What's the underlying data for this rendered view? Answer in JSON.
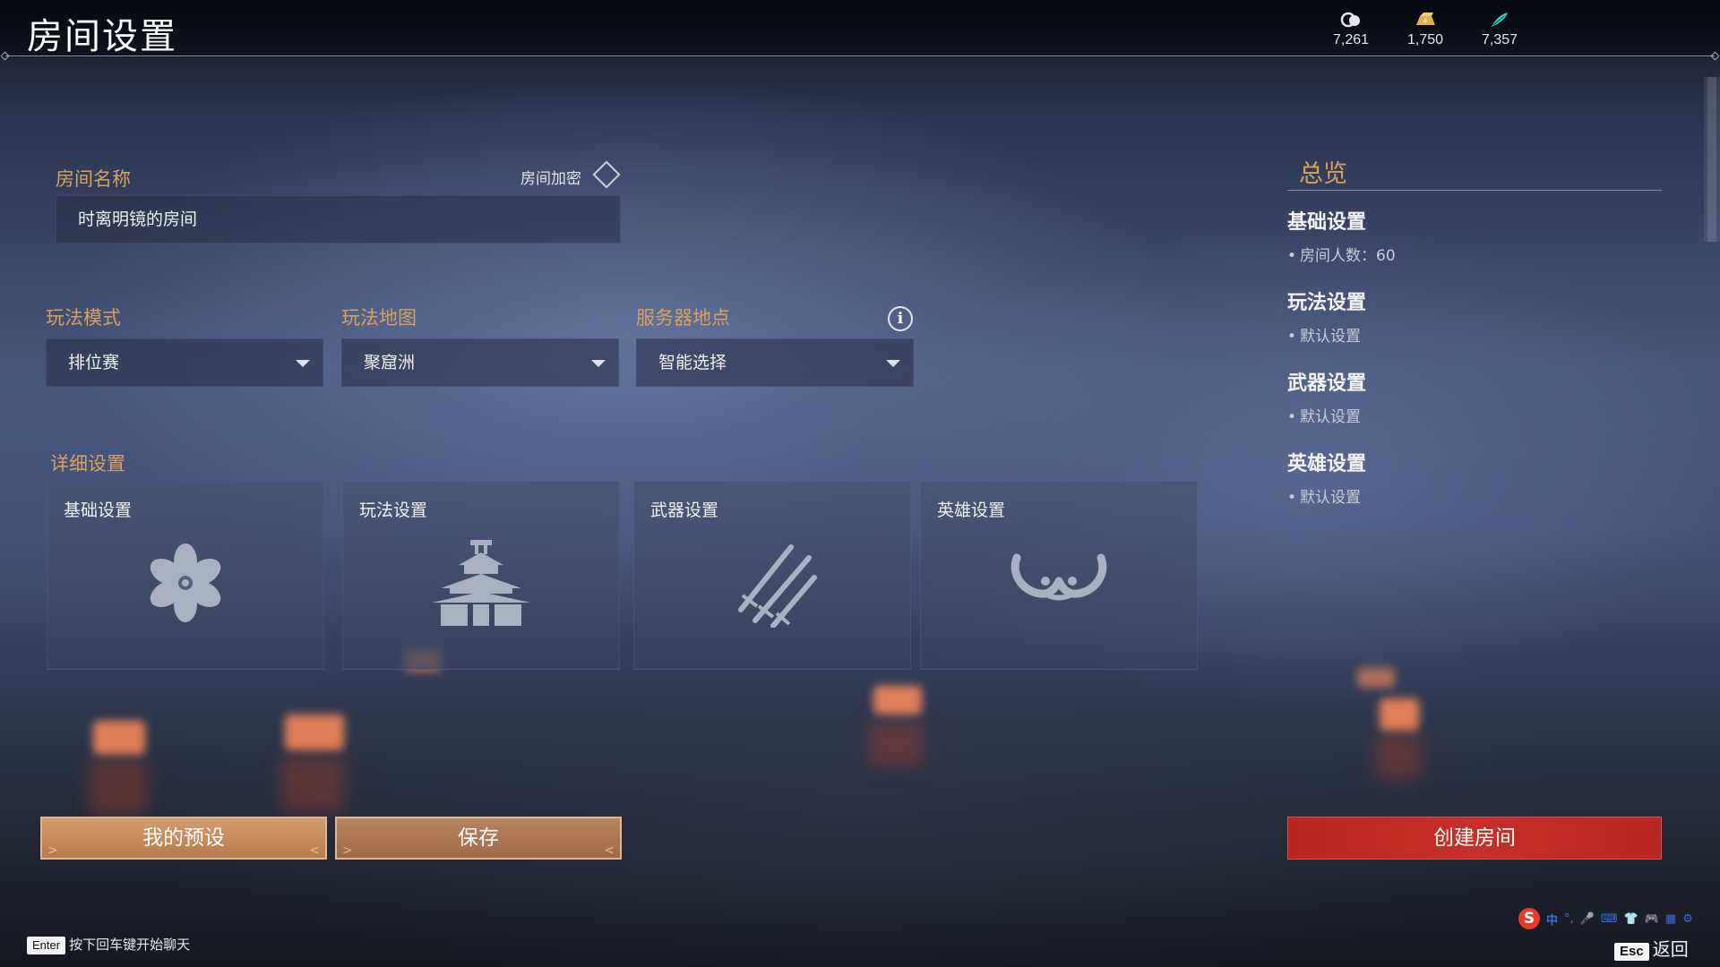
{
  "header": {
    "title": "房间设置",
    "currencies": [
      {
        "icon": "coin-icon",
        "value": "7,261"
      },
      {
        "icon": "gold-bar-icon",
        "value": "1,750"
      },
      {
        "icon": "jade-feather-icon",
        "value": "7,357"
      }
    ]
  },
  "room": {
    "name_label": "房间名称",
    "name_value": "时离明镜的房间",
    "encrypt_label": "房间加密"
  },
  "selects": {
    "mode_label": "玩法模式",
    "mode_value": "排位赛",
    "map_label": "玩法地图",
    "map_value": "聚窟洲",
    "server_label": "服务器地点",
    "server_value": "智能选择"
  },
  "details": {
    "label": "详细设置",
    "cards": [
      {
        "title": "基础设置",
        "icon": "flower-icon"
      },
      {
        "title": "玩法设置",
        "icon": "pagoda-icon"
      },
      {
        "title": "武器设置",
        "icon": "swords-icon"
      },
      {
        "title": "英雄设置",
        "icon": "horned-mask-icon"
      }
    ]
  },
  "overview": {
    "title": "总览",
    "sections": [
      {
        "title": "基础设置",
        "detail": "房间人数：60"
      },
      {
        "title": "玩法设置",
        "detail": "默认设置"
      },
      {
        "title": "武器设置",
        "detail": "默认设置"
      },
      {
        "title": "英雄设置",
        "detail": "默认设置"
      }
    ]
  },
  "buttons": {
    "preset": "我的预设",
    "save": "保存",
    "create": "创建房间"
  },
  "footer": {
    "enter_key": "Enter",
    "chat_hint": "按下回车键开始聊天",
    "esc_key": "Esc",
    "back_label": "返回"
  },
  "ime": {
    "mode": "中"
  },
  "colors": {
    "accent_gold": "#d9a061",
    "create_red": "#c73028",
    "preset_orange": "#c98a5d"
  }
}
